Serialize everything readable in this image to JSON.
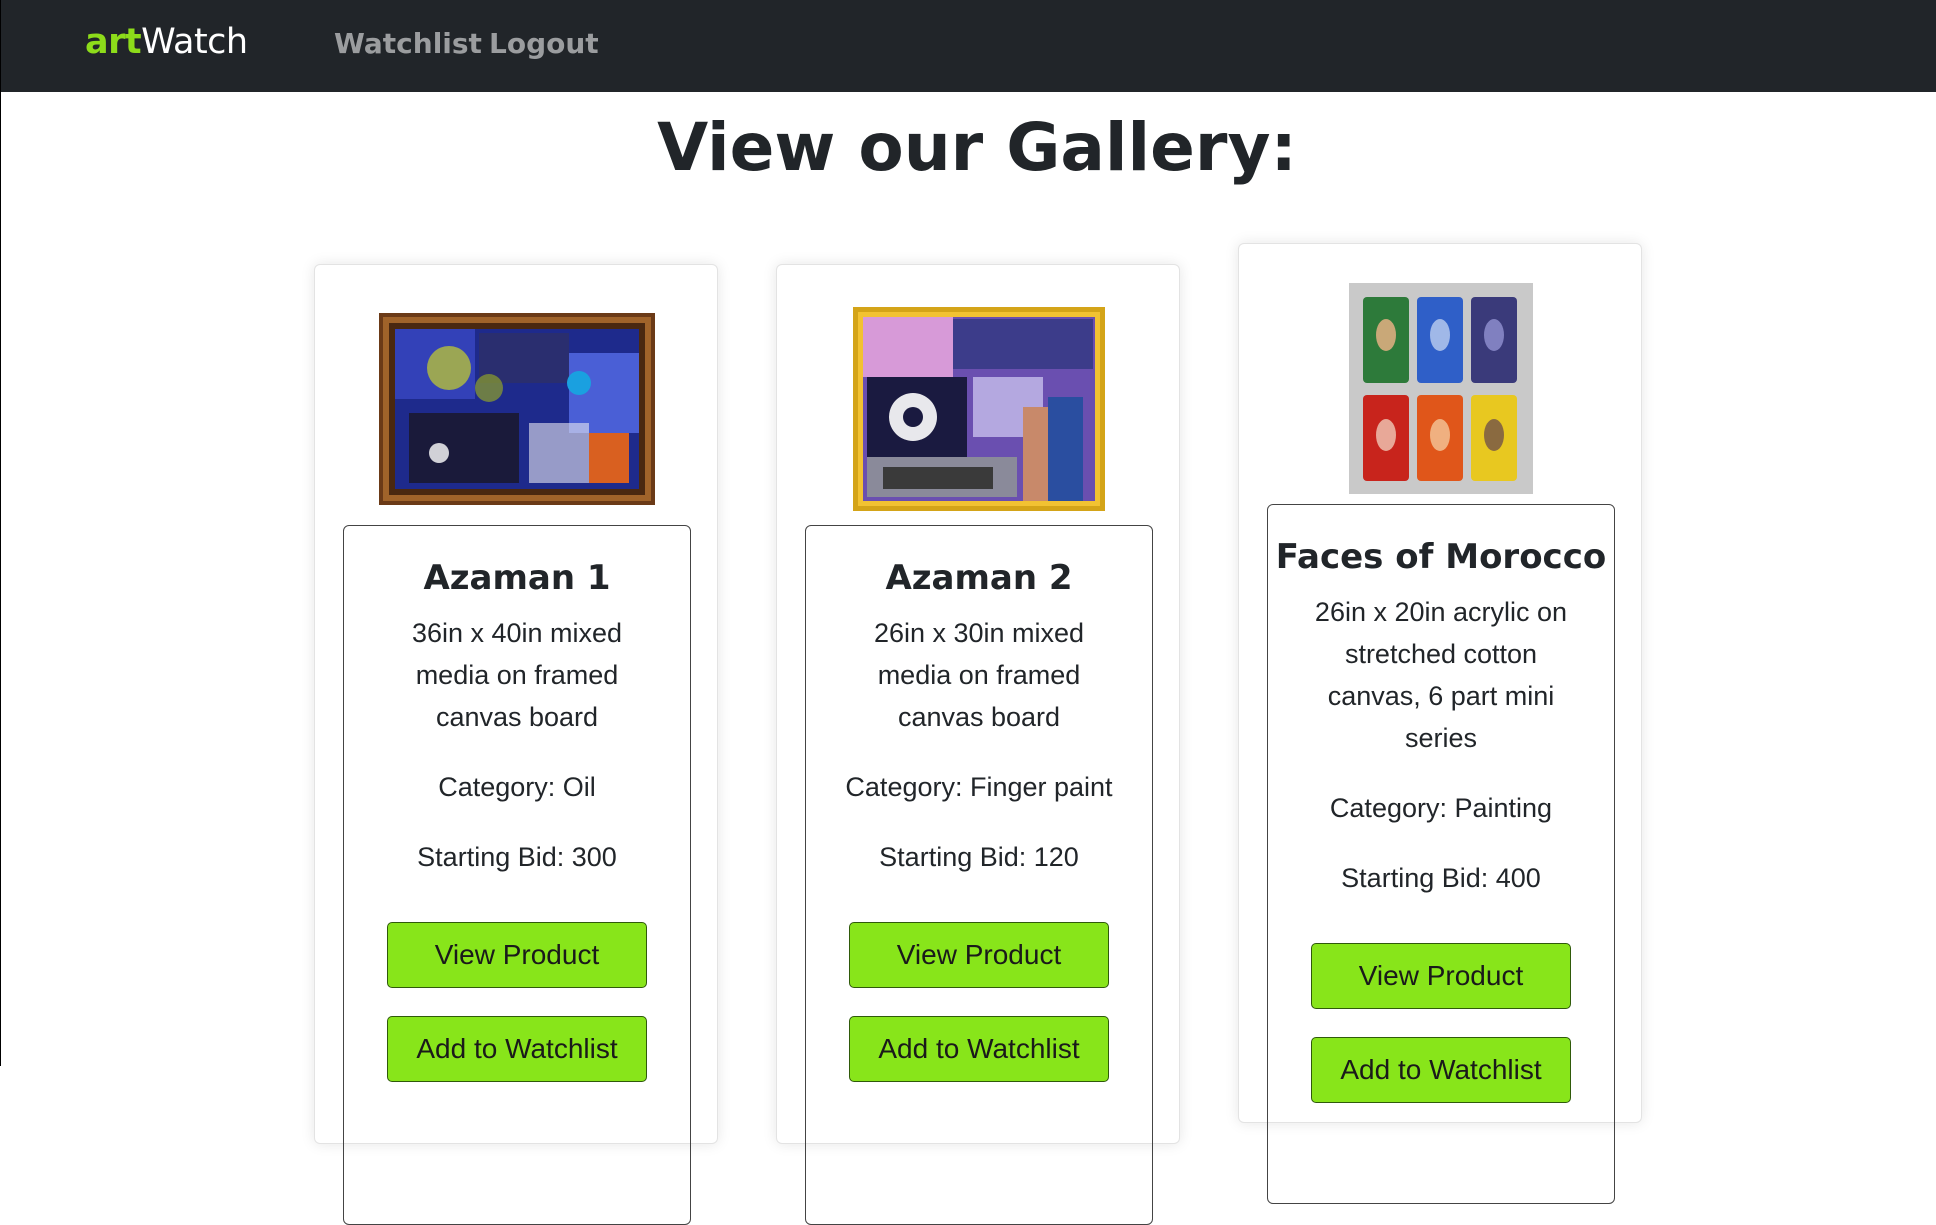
{
  "nav": {
    "brand_accent": "art",
    "brand_rest": "Watch",
    "links": [
      "Watchlist",
      "Logout"
    ]
  },
  "page": {
    "title": "View our Gallery:"
  },
  "colors": {
    "navbar_bg": "#212529",
    "brand_accent": "#8ddc1a",
    "button_bg": "#88e51a"
  },
  "products": [
    {
      "name": "Azaman 1",
      "description": "36in x 40in mixed media on framed canvas board",
      "category": "Category: Oil",
      "bid": "Starting Bid: 300",
      "view_label": "View Product",
      "watch_label": "Add to Watchlist"
    },
    {
      "name": "Azaman 2",
      "description": "26in x 30in mixed media on framed canvas board",
      "category": "Category: Finger paint",
      "bid": "Starting Bid: 120",
      "view_label": "View Product",
      "watch_label": "Add to Watchlist"
    },
    {
      "name": "Faces of Morocco",
      "description": "26in x 20in acrylic on stretched cotton canvas, 6 part mini series",
      "category": "Category: Painting",
      "bid": "Starting Bid: 400",
      "view_label": "View Product",
      "watch_label": "Add to Watchlist"
    }
  ]
}
